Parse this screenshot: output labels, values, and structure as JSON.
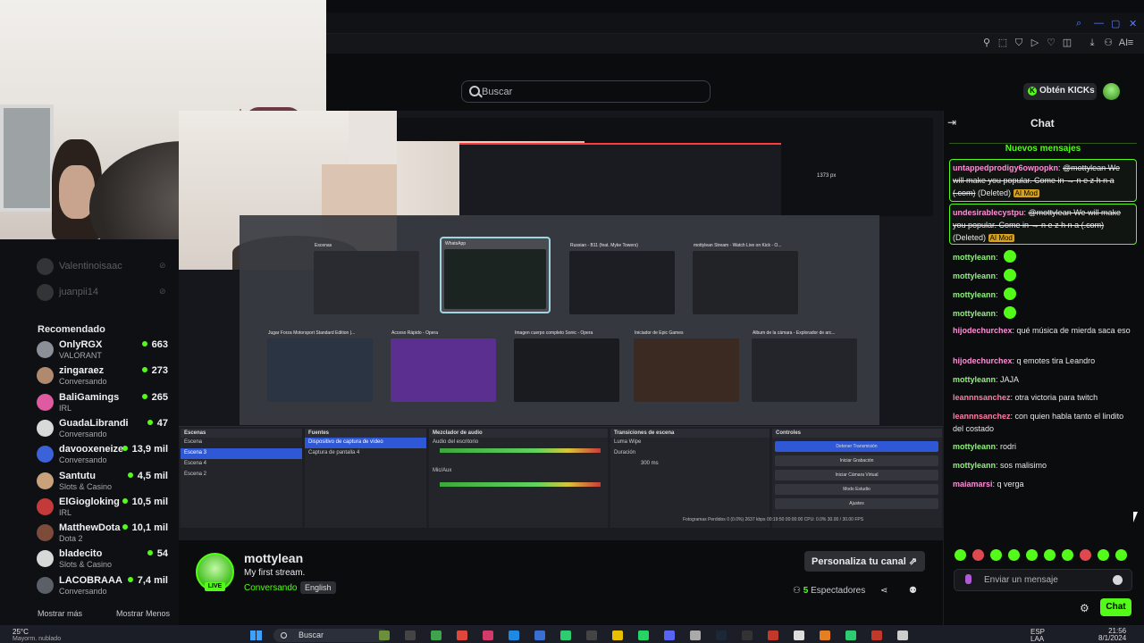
{
  "browser": {
    "window_controls": [
      "search-icon",
      "minimize-icon",
      "maximize-icon",
      "close-icon"
    ],
    "toolbar_icons": [
      "pin-icon",
      "screenshot-icon",
      "shield-icon",
      "play-icon",
      "heart-icon",
      "snapshot-icon",
      "download-icon",
      "profile-icon",
      "ai-icon",
      "menu-icon"
    ],
    "toolbar_ai_label": "AI"
  },
  "header": {
    "search_placeholder": "Buscar",
    "kicks_label": "Obtén KICKs"
  },
  "sidebar": {
    "offline": [
      {
        "name": "Valentinoisaac"
      },
      {
        "name": "juanpii14"
      }
    ],
    "recommended_title": "Recomendado",
    "recommended": [
      {
        "name": "OnlyRGX",
        "category": "VALORANT",
        "viewers": "663",
        "color": "#8a8f98"
      },
      {
        "name": "zingaraez",
        "category": "Conversando",
        "viewers": "273",
        "color": "#b08a6e"
      },
      {
        "name": "BaliGamings",
        "category": "IRL",
        "viewers": "265",
        "color": "#e05aa0"
      },
      {
        "name": "GuadaLibrandi",
        "category": "Conversando",
        "viewers": "47",
        "color": "#d9d9d9"
      },
      {
        "name": "davooxeneize",
        "category": "Conversando",
        "viewers": "13,9 mil",
        "color": "#3b62d8"
      },
      {
        "name": "Santutu",
        "category": "Slots & Casino",
        "viewers": "4,5 mil",
        "color": "#c9a27c"
      },
      {
        "name": "ElGiogloking",
        "category": "IRL",
        "viewers": "10,5 mil",
        "color": "#c43a3a"
      },
      {
        "name": "MatthewDota",
        "category": "Dota 2",
        "viewers": "10,1 mil",
        "color": "#7c4b3a"
      },
      {
        "name": "bladecito",
        "category": "Slots & Casino",
        "viewers": "54",
        "color": "#d8d8d8"
      },
      {
        "name": "LACOBRAAA",
        "category": "Conversando",
        "viewers": "7,4 mil",
        "color": "#5b5f68"
      }
    ],
    "show_more": "Mostrar más",
    "show_less": "Mostrar Menos"
  },
  "shared_screen": {
    "fps_label": "1373 px",
    "switcher_windows": [
      {
        "title": "Escenas",
        "selected": false
      },
      {
        "title": "WhatsApp",
        "selected": true
      },
      {
        "title": "Russian - B11 (feat. Myke Towers)",
        "selected": false
      },
      {
        "title": "mottylean Stream - Watch Live on Kick - O...",
        "selected": false
      },
      {
        "title": "Jugar Forza Motorsport Standard Edition |...",
        "selected": false
      },
      {
        "title": "Acceso Rápido - Opera",
        "selected": false
      },
      {
        "title": "Imagen cuerpo completo Sonic - Opera",
        "selected": false
      },
      {
        "title": "Iniciador de Epic Games",
        "selected": false
      },
      {
        "title": "Álbum de la cámara - Explorador de arc...",
        "selected": false
      }
    ],
    "obs": {
      "scenes_title": "Escenas",
      "scenes": [
        "Escena",
        "Escena 3",
        "Escena 4",
        "Escena 2"
      ],
      "sources_title": "Fuentes",
      "sources": [
        "Dispositivo de captura de vídeo",
        "Captura de pantalla 4"
      ],
      "mixer_title": "Mezclador de audio",
      "mixer_channels": [
        "Audio del escritorio",
        "Mic/Aux"
      ],
      "transitions_title": "Transiciones de escena",
      "transition_value": "Luma Wipe",
      "duration_label": "Duración",
      "duration_value": "300 ms",
      "controls_title": "Controles",
      "controls": [
        "Detener Transmisión",
        "Iniciar Grabación",
        "Iniciar Cámara Virtual",
        "Modo Estudio",
        "Ajustes"
      ],
      "status": "Fotogramas Perdidos 0 (0.0%)   2637 kbps   00:19:50   00:00:00   CPU: 0.0%   30.00 / 30.00 FPS"
    }
  },
  "stream": {
    "channel": "mottylean",
    "live_label": "LIVE",
    "title": "My first stream.",
    "category": "Conversando",
    "language": "English",
    "customize_label": "Personaliza tu canal",
    "viewers_count": "5",
    "viewers_label": "Espectadores"
  },
  "chat": {
    "title": "Chat",
    "new_messages": "Nuevos mensajes",
    "messages": [
      {
        "user": "untappedprodigy6owpopkn",
        "text": "@mottylean We will make you popular. Come in → n e z h n a (.com)",
        "deleted": true,
        "deleted_label": "(Deleted)",
        "tag": "AI Mod"
      },
      {
        "user": "undesirablecystpu",
        "text": "@mottylean We will make you popular. Come in → n e z h n a (.com)",
        "deleted": true,
        "deleted_label": "(Deleted)",
        "tag": "AI Mod"
      },
      {
        "user": "mottyleann",
        "text": "",
        "emote": true
      },
      {
        "user": "mottyleann",
        "text": "",
        "emote": true
      },
      {
        "user": "mottyleann",
        "text": "",
        "emote": true
      },
      {
        "user": "mottyleann",
        "text": "",
        "emote": true
      },
      {
        "user": "hijodechurchex",
        "text": "qué música de mierda saca eso"
      },
      {
        "user": "hijodechurchex",
        "text": "q emotes tira Leandro"
      },
      {
        "user": "mottyleann",
        "text": "JAJA"
      },
      {
        "user": "leannnsanchez",
        "text": "otra victoria para twitch"
      },
      {
        "user": "leannnsanchez",
        "text": "con quien habla tanto el lindito del costado"
      },
      {
        "user": "mottyleann",
        "text": "rodri"
      },
      {
        "user": "mottyleann",
        "text": "sos malisimo"
      },
      {
        "user": "maiamarsi",
        "text": "q verga"
      }
    ],
    "input_placeholder": "Enviar un mensaje",
    "send_label": "Chat"
  },
  "taskbar": {
    "weather_temp": "25°C",
    "weather_desc": "Mayorm. nublado",
    "search_label": "Buscar",
    "lang_1": "ESP",
    "lang_2": "LAA",
    "time": "21:56",
    "date": "8/1/2024"
  },
  "colors": {
    "kick_green": "#53fc18",
    "background": "#0b0c0e",
    "ai_mod_tag": "#d6a21e"
  }
}
